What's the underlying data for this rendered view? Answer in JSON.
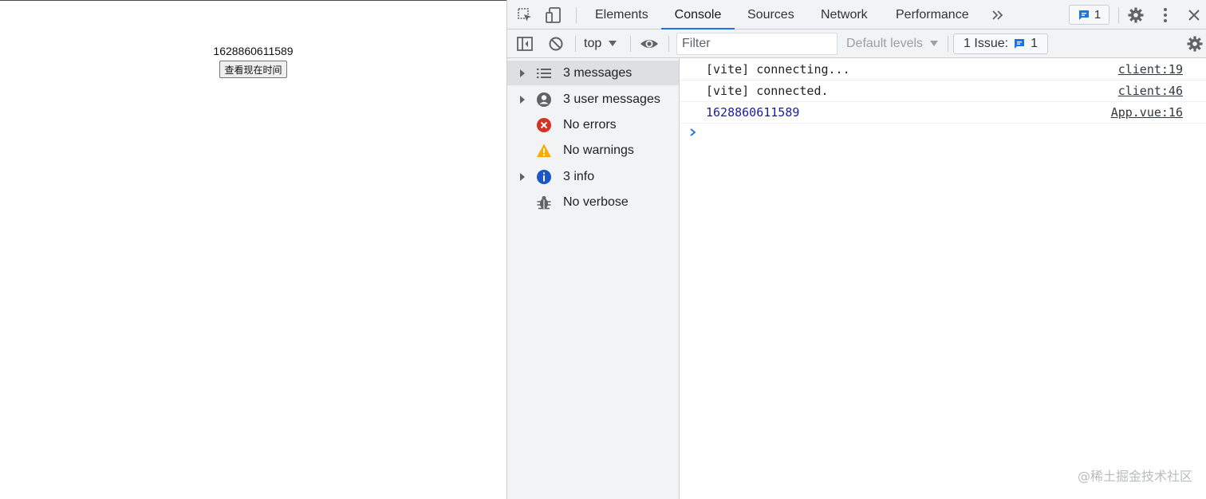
{
  "page": {
    "timestamp": "1628860611589",
    "button_label": "查看现在时间"
  },
  "devtools": {
    "tabs": [
      {
        "label": "Elements"
      },
      {
        "label": "Console"
      },
      {
        "label": "Sources"
      },
      {
        "label": "Network"
      },
      {
        "label": "Performance"
      }
    ],
    "active_tab": "Console",
    "message_badge_count": "1",
    "toolbar": {
      "context": "top",
      "filter_placeholder": "Filter",
      "levels_label": "Default levels",
      "issues_label": "1 Issue:",
      "issues_count": "1"
    },
    "sidebar": {
      "items": [
        {
          "label": "3 messages",
          "icon": "list-icon",
          "expandable": true,
          "selected": true
        },
        {
          "label": "3 user messages",
          "icon": "user-circle-icon",
          "expandable": true,
          "selected": false
        },
        {
          "label": "No errors",
          "icon": "error-icon",
          "expandable": false,
          "selected": false
        },
        {
          "label": "No warnings",
          "icon": "warning-icon",
          "expandable": false,
          "selected": false
        },
        {
          "label": "3 info",
          "icon": "info-icon",
          "expandable": true,
          "selected": false
        },
        {
          "label": "No verbose",
          "icon": "bug-icon",
          "expandable": false,
          "selected": false
        }
      ]
    },
    "console": {
      "logs": [
        {
          "text": "[vite] connecting...",
          "source": "client:19"
        },
        {
          "text": "[vite] connected.",
          "source": "client:46"
        },
        {
          "text": "1628860611589",
          "source": "App.vue:16"
        }
      ]
    },
    "watermark": "@稀土掘金技术社区"
  },
  "colors": {
    "accent": "#1a73e8",
    "error": "#d93025",
    "warning": "#f9ab00",
    "info": "#1a56c8",
    "number_value": "#1a1aa6"
  }
}
